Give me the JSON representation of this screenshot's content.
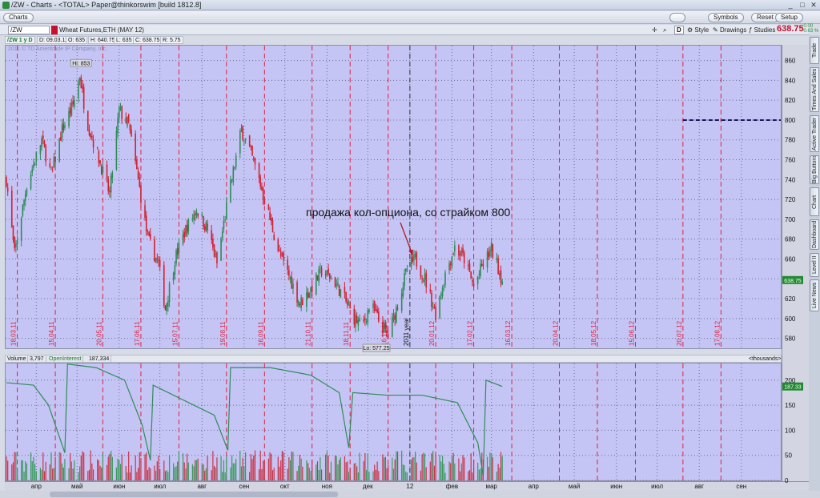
{
  "window": {
    "title": "/ZW - Charts - <TOTAL> Paper@thinkorswim [build 1812.8]",
    "buttons": {
      "minimize": "_",
      "maximize": "□",
      "close": "✕"
    }
  },
  "menubar": {
    "charts_label": "Charts",
    "symbols_label": "Symbols",
    "reset_label": "Reset",
    "setup_label": "Setup"
  },
  "toolbar": {
    "symbol": "/ZW",
    "description": "Wheat Futures,ETH (MAY 12)",
    "d_label": "D",
    "style_label": "Style",
    "drawings_label": "Drawings",
    "studies_label": "Studies",
    "last_price": "638.75",
    "change_top": "+0.00",
    "change_bottom": "+0.63 %"
  },
  "infobar": {
    "period": "/ZW 1 y D",
    "date": "D: 09.03.12",
    "open": "O: 635",
    "high": "H: 640.75",
    "low": "L: 635",
    "close": "C: 638.75",
    "range": "R: 5.75"
  },
  "copyright": "2011 © TD Ameritrade IP Company, Inc.",
  "sidetabs": [
    "Trade",
    "Times And Sales",
    "Active Trader",
    "Big Buttons",
    "Chart",
    "Dashboard",
    "Level II",
    "Live News"
  ],
  "colors": {
    "panel_bg": "#c5c5f5",
    "up_candle": "#2e8b57",
    "down_candle": "#d42030",
    "period_line": "#e02040",
    "strike_line": "#1a1a60",
    "oi_line": "#2e8b57",
    "price_badge": "#1f8a2f"
  },
  "annotation": {
    "text": "продажа кол-опциона, со страйком 800"
  },
  "volume_header": {
    "volume_label": "Volume",
    "volume_value": "3,797",
    "oi_label": "OpenInterest",
    "oi_value": "187,334",
    "units": "<thousands>"
  },
  "chart_data": [
    {
      "type": "candlestick",
      "title": "/ZW Wheat Futures,ETH (MAY 12) 1 y D",
      "ylim": [
        570,
        875
      ],
      "y_ticks": [
        580,
        600,
        620,
        640,
        660,
        680,
        700,
        720,
        740,
        760,
        780,
        800,
        820,
        840,
        860
      ],
      "x_range": [
        "2011-03-10",
        "2012-09-30"
      ],
      "grid": true,
      "period_labels": [
        "18.03.11",
        "15.04.11",
        "20.05.11",
        "17.06.11",
        "15.07.11",
        "19.08.11",
        "16.09.11",
        "21.10.11",
        "18.11.11",
        "16.12.11",
        "2011 year",
        "20.01.12",
        "17.02.12",
        "16.03.12",
        "20.04.12",
        "18.05.12",
        "15.06.12",
        "20.07.12",
        "17.08.12"
      ],
      "period_dates": [
        "2011-03-18",
        "2011-04-15",
        "2011-05-20",
        "2011-06-17",
        "2011-07-15",
        "2011-08-19",
        "2011-09-16",
        "2011-10-21",
        "2011-11-18",
        "2011-12-16",
        "2012-01-01",
        "2012-01-20",
        "2012-02-17",
        "2012-03-16",
        "2012-04-20",
        "2012-05-18",
        "2012-06-15",
        "2012-07-20",
        "2012-08-17"
      ],
      "close_path": [
        {
          "date": "2011-03-10",
          "close": 740
        },
        {
          "date": "2011-03-16",
          "close": 665
        },
        {
          "date": "2011-03-25",
          "close": 735
        },
        {
          "date": "2011-04-05",
          "close": 780
        },
        {
          "date": "2011-04-12",
          "close": 745
        },
        {
          "date": "2011-04-20",
          "close": 790
        },
        {
          "date": "2011-04-28",
          "close": 815
        },
        {
          "date": "2011-05-03",
          "close": 845
        },
        {
          "date": "2011-05-08",
          "close": 800
        },
        {
          "date": "2011-05-15",
          "close": 770
        },
        {
          "date": "2011-05-25",
          "close": 725
        },
        {
          "date": "2011-06-01",
          "close": 810
        },
        {
          "date": "2011-06-08",
          "close": 795
        },
        {
          "date": "2011-06-15",
          "close": 740
        },
        {
          "date": "2011-06-22",
          "close": 680
        },
        {
          "date": "2011-06-30",
          "close": 655
        },
        {
          "date": "2011-07-05",
          "close": 610
        },
        {
          "date": "2011-07-12",
          "close": 660
        },
        {
          "date": "2011-07-20",
          "close": 690
        },
        {
          "date": "2011-07-28",
          "close": 710
        },
        {
          "date": "2011-08-05",
          "close": 690
        },
        {
          "date": "2011-08-12",
          "close": 655
        },
        {
          "date": "2011-08-20",
          "close": 720
        },
        {
          "date": "2011-08-30",
          "close": 790
        },
        {
          "date": "2011-09-05",
          "close": 770
        },
        {
          "date": "2011-09-12",
          "close": 740
        },
        {
          "date": "2011-09-20",
          "close": 700
        },
        {
          "date": "2011-09-27",
          "close": 665
        },
        {
          "date": "2011-10-05",
          "close": 640
        },
        {
          "date": "2011-10-12",
          "close": 615
        },
        {
          "date": "2011-10-20",
          "close": 630
        },
        {
          "date": "2011-10-28",
          "close": 648
        },
        {
          "date": "2011-11-05",
          "close": 640
        },
        {
          "date": "2011-11-12",
          "close": 625
        },
        {
          "date": "2011-11-20",
          "close": 602
        },
        {
          "date": "2011-11-27",
          "close": 592
        },
        {
          "date": "2011-12-03",
          "close": 615
        },
        {
          "date": "2011-12-10",
          "close": 595
        },
        {
          "date": "2011-12-16",
          "close": 582
        },
        {
          "date": "2011-12-22",
          "close": 610
        },
        {
          "date": "2011-12-30",
          "close": 650
        },
        {
          "date": "2012-01-05",
          "close": 660
        },
        {
          "date": "2012-01-12",
          "close": 640
        },
        {
          "date": "2012-01-20",
          "close": 605
        },
        {
          "date": "2012-01-27",
          "close": 645
        },
        {
          "date": "2012-02-03",
          "close": 672
        },
        {
          "date": "2012-02-10",
          "close": 660
        },
        {
          "date": "2012-02-17",
          "close": 632
        },
        {
          "date": "2012-02-24",
          "close": 655
        },
        {
          "date": "2012-03-01",
          "close": 670
        },
        {
          "date": "2012-03-05",
          "close": 655
        },
        {
          "date": "2012-03-09",
          "close": 638.75
        }
      ],
      "annotations": [
        {
          "text": "Hi: 853",
          "date": "2011-05-04",
          "value": 853
        },
        {
          "text": "Lo: 577.25",
          "date": "2011-12-15",
          "value": 577.25
        },
        {
          "text": "продажа кол-опциона, со страйком 800",
          "arrow_to_date": "2012-01-03",
          "arrow_to_value": 664
        }
      ],
      "horizontal_lines": [
        {
          "value": 800,
          "from_date": "2012-07-20",
          "to_date": "2012-09-30",
          "style": "dashed"
        }
      ],
      "last_price_label": "638.75"
    },
    {
      "type": "bar+line",
      "title": "Volume / OpenInterest",
      "ylim": [
        0,
        230
      ],
      "y_ticks": [
        0,
        50,
        100,
        150,
        200
      ],
      "units": "<thousands>",
      "series": [
        {
          "name": "Volume",
          "type": "bar",
          "last": 3.797
        },
        {
          "name": "OpenInterest",
          "type": "line",
          "last": 187.334,
          "points": [
            {
              "date": "2011-03-10",
              "value": 195
            },
            {
              "date": "2011-03-30",
              "value": 190
            },
            {
              "date": "2011-04-10",
              "value": 150
            },
            {
              "date": "2011-04-22",
              "value": 55
            },
            {
              "date": "2011-04-24",
              "value": 232
            },
            {
              "date": "2011-05-15",
              "value": 225
            },
            {
              "date": "2011-06-05",
              "value": 200
            },
            {
              "date": "2011-06-18",
              "value": 110
            },
            {
              "date": "2011-06-24",
              "value": 40
            },
            {
              "date": "2011-06-26",
              "value": 190
            },
            {
              "date": "2011-08-10",
              "value": 130
            },
            {
              "date": "2011-08-20",
              "value": 60
            },
            {
              "date": "2011-08-22",
              "value": 225
            },
            {
              "date": "2011-09-20",
              "value": 225
            },
            {
              "date": "2011-10-20",
              "value": 210
            },
            {
              "date": "2011-11-10",
              "value": 175
            },
            {
              "date": "2011-11-17",
              "value": 65
            },
            {
              "date": "2011-11-20",
              "value": 175
            },
            {
              "date": "2011-12-15",
              "value": 170
            },
            {
              "date": "2012-01-10",
              "value": 170
            },
            {
              "date": "2012-02-05",
              "value": 155
            },
            {
              "date": "2012-02-20",
              "value": 75
            },
            {
              "date": "2012-02-24",
              "value": 10
            },
            {
              "date": "2012-02-26",
              "value": 200
            },
            {
              "date": "2012-03-09",
              "value": 187.334
            }
          ]
        }
      ],
      "x_ticks": [
        "апр",
        "май",
        "июн",
        "июл",
        "авг",
        "сен",
        "окт",
        "ноя",
        "дек",
        "12",
        "фев",
        "мар",
        "апр",
        "май",
        "июн",
        "июл",
        "авг",
        "сен"
      ],
      "x_tick_dates": [
        "2011-04-01",
        "2011-05-01",
        "2011-06-01",
        "2011-07-01",
        "2011-08-01",
        "2011-09-01",
        "2011-10-01",
        "2011-11-01",
        "2011-12-01",
        "2012-01-01",
        "2012-02-01",
        "2012-03-01",
        "2012-04-01",
        "2012-05-01",
        "2012-06-01",
        "2012-07-01",
        "2012-08-01",
        "2012-09-01"
      ],
      "last_value_label": "187.33"
    }
  ]
}
